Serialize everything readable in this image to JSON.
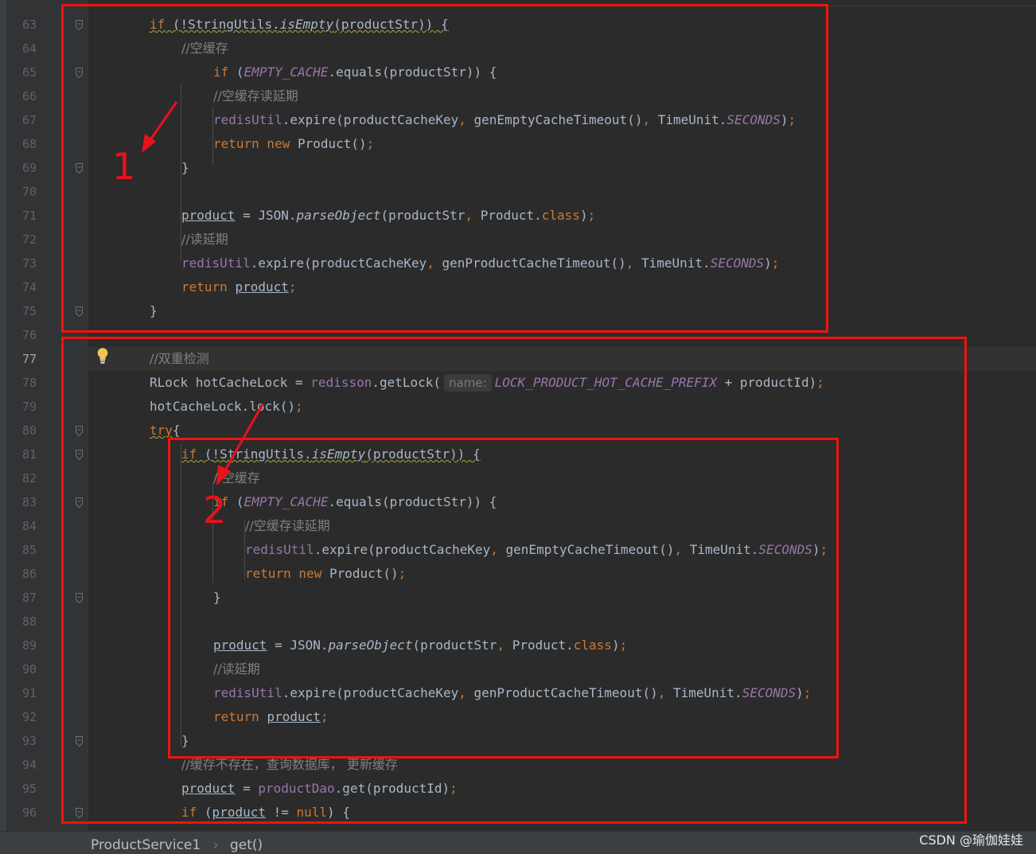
{
  "lines": [
    {
      "n": "63",
      "segs": [
        {
          "t": "if",
          "c": "kw squig"
        },
        {
          "t": " (!StringUtils.",
          "c": "squig"
        },
        {
          "t": "isEmpty",
          "c": "mth-static squig"
        },
        {
          "t": "(productStr)) {",
          "c": "squig"
        }
      ]
    },
    {
      "n": "64",
      "segs": [
        {
          "t": "//空缓存",
          "c": "cm"
        }
      ]
    },
    {
      "n": "65",
      "segs": [
        {
          "t": "if ",
          "c": "kw"
        },
        {
          "t": "("
        },
        {
          "t": "EMPTY_CACHE",
          "c": "static-fld"
        },
        {
          "t": ".equals(productStr)) {"
        }
      ]
    },
    {
      "n": "66",
      "segs": [
        {
          "t": "//空缓存读延期",
          "c": "cm"
        }
      ]
    },
    {
      "n": "67",
      "segs": [
        {
          "t": "redisUtil",
          "c": "fld"
        },
        {
          "t": ".expire(productCacheKey"
        },
        {
          "t": ", ",
          "c": "kw"
        },
        {
          "t": "genEmptyCacheTimeout()"
        },
        {
          "t": ", ",
          "c": "kw"
        },
        {
          "t": "TimeUnit."
        },
        {
          "t": "SECONDS",
          "c": "static-fld"
        },
        {
          "t": ")"
        },
        {
          "t": ";",
          "c": "kw"
        }
      ]
    },
    {
      "n": "68",
      "segs": [
        {
          "t": "return new ",
          "c": "kw"
        },
        {
          "t": "Product()"
        },
        {
          "t": ";",
          "c": "kw"
        }
      ]
    },
    {
      "n": "69",
      "segs": [
        {
          "t": "}"
        }
      ]
    },
    {
      "n": "70",
      "segs": []
    },
    {
      "n": "71",
      "segs": [
        {
          "t": "product",
          "c": "under"
        },
        {
          "t": " = JSON."
        },
        {
          "t": "parseObject",
          "c": "mth-static"
        },
        {
          "t": "(productStr"
        },
        {
          "t": ", ",
          "c": "kw"
        },
        {
          "t": "Product."
        },
        {
          "t": "class",
          "c": "kw"
        },
        {
          "t": ")"
        },
        {
          "t": ";",
          "c": "kw"
        }
      ]
    },
    {
      "n": "72",
      "segs": [
        {
          "t": "//读延期",
          "c": "cm"
        }
      ]
    },
    {
      "n": "73",
      "segs": [
        {
          "t": "redisUtil",
          "c": "fld"
        },
        {
          "t": ".expire(productCacheKey"
        },
        {
          "t": ", ",
          "c": "kw"
        },
        {
          "t": "genProductCacheTimeout()"
        },
        {
          "t": ", ",
          "c": "kw"
        },
        {
          "t": "TimeUnit."
        },
        {
          "t": "SECONDS",
          "c": "static-fld"
        },
        {
          "t": ")"
        },
        {
          "t": ";",
          "c": "kw"
        }
      ]
    },
    {
      "n": "74",
      "segs": [
        {
          "t": "return ",
          "c": "kw"
        },
        {
          "t": "product",
          "c": "under"
        },
        {
          "t": ";",
          "c": "kw"
        }
      ]
    },
    {
      "n": "75",
      "segs": [
        {
          "t": "}"
        }
      ]
    },
    {
      "n": "76",
      "segs": []
    },
    {
      "n": "77",
      "segs": [
        {
          "t": "//双重检测",
          "c": "cm"
        }
      ]
    },
    {
      "n": "78",
      "segs": [
        {
          "t": "RLock hotCacheLock = "
        },
        {
          "t": "redisson",
          "c": "fld"
        },
        {
          "t": ".getLock("
        },
        {
          "t": "name:",
          "c": "hint"
        },
        {
          "t": "LOCK_PRODUCT_HOT_CACHE_PREFIX",
          "c": "static-fld"
        },
        {
          "t": " + productId)"
        },
        {
          "t": ";",
          "c": "kw"
        }
      ]
    },
    {
      "n": "79",
      "segs": [
        {
          "t": "hotCacheLock.lock()"
        },
        {
          "t": ";",
          "c": "kw"
        }
      ]
    },
    {
      "n": "80",
      "segs": [
        {
          "t": "try",
          "c": "kw squig"
        },
        {
          "t": "{"
        }
      ]
    },
    {
      "n": "81",
      "segs": [
        {
          "t": "if",
          "c": "kw squig"
        },
        {
          "t": " (!StringUtils.",
          "c": "squig"
        },
        {
          "t": "isEmpty",
          "c": "mth-static squig"
        },
        {
          "t": "(productStr)) {",
          "c": "squig"
        }
      ]
    },
    {
      "n": "82",
      "segs": [
        {
          "t": "//空缓存",
          "c": "cm"
        }
      ]
    },
    {
      "n": "83",
      "segs": [
        {
          "t": "if ",
          "c": "kw"
        },
        {
          "t": "("
        },
        {
          "t": "EMPTY_CACHE",
          "c": "static-fld"
        },
        {
          "t": ".equals(productStr)) {"
        }
      ]
    },
    {
      "n": "84",
      "segs": [
        {
          "t": "//空缓存读延期",
          "c": "cm"
        }
      ]
    },
    {
      "n": "85",
      "segs": [
        {
          "t": "redisUtil",
          "c": "fld"
        },
        {
          "t": ".expire(productCacheKey"
        },
        {
          "t": ", ",
          "c": "kw"
        },
        {
          "t": "genEmptyCacheTimeout()"
        },
        {
          "t": ", ",
          "c": "kw"
        },
        {
          "t": "TimeUnit."
        },
        {
          "t": "SECONDS",
          "c": "static-fld"
        },
        {
          "t": ")"
        },
        {
          "t": ";",
          "c": "kw"
        }
      ]
    },
    {
      "n": "86",
      "segs": [
        {
          "t": "return new ",
          "c": "kw"
        },
        {
          "t": "Product()"
        },
        {
          "t": ";",
          "c": "kw"
        }
      ]
    },
    {
      "n": "87",
      "segs": [
        {
          "t": "}"
        }
      ]
    },
    {
      "n": "88",
      "segs": []
    },
    {
      "n": "89",
      "segs": [
        {
          "t": "product",
          "c": "under"
        },
        {
          "t": " = JSON."
        },
        {
          "t": "parseObject",
          "c": "mth-static"
        },
        {
          "t": "(productStr"
        },
        {
          "t": ", ",
          "c": "kw"
        },
        {
          "t": "Product."
        },
        {
          "t": "class",
          "c": "kw"
        },
        {
          "t": ")"
        },
        {
          "t": ";",
          "c": "kw"
        }
      ]
    },
    {
      "n": "90",
      "segs": [
        {
          "t": "//读延期",
          "c": "cm"
        }
      ]
    },
    {
      "n": "91",
      "segs": [
        {
          "t": "redisUtil",
          "c": "fld"
        },
        {
          "t": ".expire(productCacheKey"
        },
        {
          "t": ", ",
          "c": "kw"
        },
        {
          "t": "genProductCacheTimeout()"
        },
        {
          "t": ", ",
          "c": "kw"
        },
        {
          "t": "TimeUnit."
        },
        {
          "t": "SECONDS",
          "c": "static-fld"
        },
        {
          "t": ")"
        },
        {
          "t": ";",
          "c": "kw"
        }
      ]
    },
    {
      "n": "92",
      "segs": [
        {
          "t": "return ",
          "c": "kw"
        },
        {
          "t": "product",
          "c": "under"
        },
        {
          "t": ";",
          "c": "kw"
        }
      ]
    },
    {
      "n": "93",
      "segs": [
        {
          "t": "}"
        }
      ]
    },
    {
      "n": "94",
      "segs": [
        {
          "t": "//缓存不存在，查询数据库， 更新缓存",
          "c": "cm"
        }
      ]
    },
    {
      "n": "95",
      "segs": [
        {
          "t": "product",
          "c": "under"
        },
        {
          "t": " = "
        },
        {
          "t": "productDao",
          "c": "fld"
        },
        {
          "t": ".get(productId)"
        },
        {
          "t": ";",
          "c": "kw"
        }
      ]
    },
    {
      "n": "96",
      "segs": [
        {
          "t": "if ",
          "c": "kw"
        },
        {
          "t": "("
        },
        {
          "t": "product",
          "c": "under"
        },
        {
          "t": " != "
        },
        {
          "t": "null",
          "c": "kw"
        },
        {
          "t": ") {"
        }
      ]
    }
  ],
  "current_line": "77",
  "annotations": {
    "label1": "1",
    "label2": "2",
    "annotation_color": "#f0130c"
  },
  "breadcrumb": {
    "class_name": "ProductService1",
    "separator": "›",
    "method_name": "get()"
  },
  "watermark": "CSDN @瑜伽娃娃",
  "icons": {
    "intention": "lightbulb-icon",
    "fold": "fold-marker-icon"
  },
  "theme": {
    "background": "#2b2b2b",
    "keyword": "#cc7832",
    "comment": "#808080",
    "field": "#9876aa",
    "text": "#a9b7c6"
  }
}
